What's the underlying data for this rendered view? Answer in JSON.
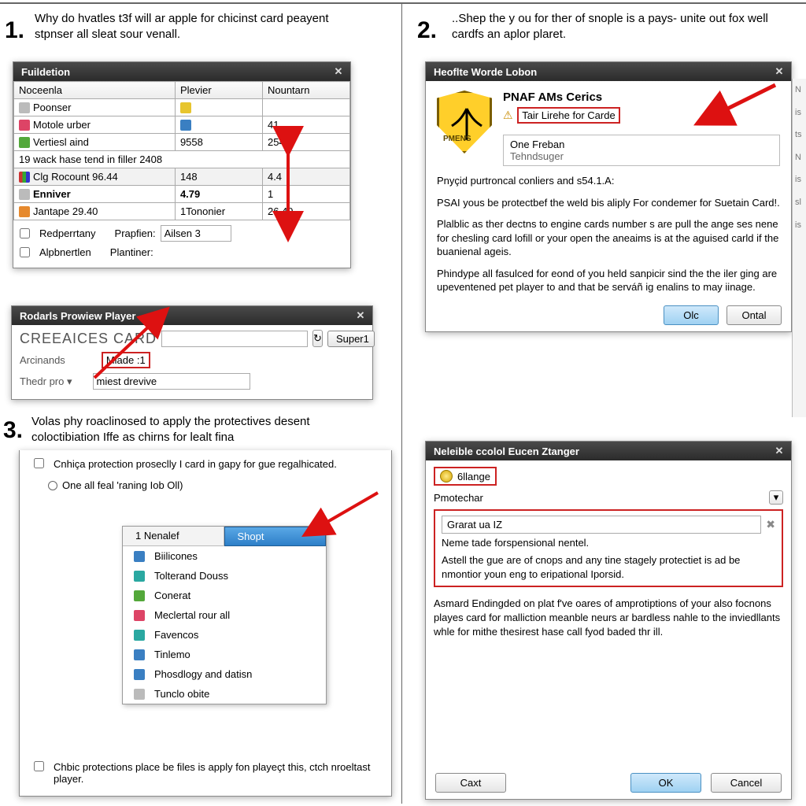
{
  "steps": {
    "1": {
      "number": "1.",
      "text": "Why do hvatles t3f will ar apple for chicinst card peayent stpnser all sleat sour venall."
    },
    "2": {
      "number": "2.",
      "text": "..Shep the y ou for ther of snople is a pays- unite out fox well cardfs an aplor plaret."
    },
    "3": {
      "number": "3.",
      "text": "Volas phy roaclinosed to apply the protectives desent coloctibiation Iffe as chirns for lealt fina"
    }
  },
  "panel1": {
    "title": "Fuildetion",
    "columns": [
      "Noceenla",
      "Plevier",
      "Nountarn"
    ],
    "rows": [
      {
        "icon": "mi-grey",
        "c0": "Poonser",
        "c1": "",
        "c1i": "mi-yellow",
        "c2": ""
      },
      {
        "icon": "mi-pink",
        "c0": "Motole urber",
        "c1": "",
        "c1i": "mi-blue",
        "c2": "41"
      },
      {
        "icon": "mi-green",
        "c0": "Vertiesl aind",
        "c1": "9558",
        "c2": "2544"
      },
      {
        "icon": "",
        "c0": "19 wack hase tend in filler 2408",
        "c1": "",
        "c2": "",
        "span": 3
      },
      {
        "icon": "mi-bar",
        "c0": "Clg Rocount   96.44",
        "c1": "148",
        "c2": "4.4",
        "sel": true
      },
      {
        "icon": "mi-grey",
        "c0": "Enniver",
        "c1": "4.79",
        "c2": "1",
        "bold": true
      },
      {
        "icon": "mi-orange",
        "c0": "Jantape           29.40",
        "c1": "1Tononier",
        "c2": "26.49"
      }
    ],
    "optrows": [
      {
        "label": "Redperrtany",
        "field": "Prapfien:",
        "value": "Ailsen 3"
      },
      {
        "label": "Alpbnertlen",
        "field": "Plantiner:",
        "value": ""
      }
    ]
  },
  "panel1b": {
    "title": "Rodarls Prowiew Player",
    "heading": "CREEAICES CARD",
    "refresh_aria": "refresh",
    "super_btn": "Super1",
    "field1_label": "Arcinands",
    "field1_value": "Miade :1",
    "field2_label": "Thedr pro ▾",
    "field2_value": "miest drevive"
  },
  "panel2": {
    "title": "Heoflte Worde Lobon",
    "shield_label": "PMENS",
    "head_title": "PNAF AMs Cerics",
    "head_sub": "Tair Lirehe for Carde",
    "sub1": "One Freban",
    "sub2": "Tehndsuger",
    "p1": "Pnyçid purtroncal conliers and s54.1.A:",
    "p2": "PSAI yous be protectbef the weld bis aliply For condemer for Suetain Card!.",
    "p3": "Plalblic as ther dectns to engine cards number s are pull the ange ses nene for chesling card lofill or your open the aneaims is at the aguised carld if the buanienal ageis.",
    "p4": "Phindype all fasulced for eond of you held sanpicir sind the the iler ging are upeventened pet player to and that be serváñ ig enalins to may iinage.",
    "btn_left": "Olc",
    "btn_right": "Ontal"
  },
  "panel3": {
    "check_top": "Cnhiça protection proseclly I card in gapy for gue regalhicated.",
    "radio": "One all feal 'raning Iob Oll)",
    "menu_header_left": "1    Nenalef",
    "menu_header_right": "Shopt",
    "items": [
      {
        "icon": "mi-blue",
        "label": "Biilicones"
      },
      {
        "icon": "mi-teal",
        "label": "Tolterand Douss"
      },
      {
        "icon": "mi-green",
        "label": "Conerat"
      },
      {
        "icon": "mi-pink",
        "label": "Meclertal rour all"
      },
      {
        "icon": "mi-teal",
        "label": "Favencos"
      },
      {
        "icon": "mi-blue",
        "label": "Tinlemo"
      },
      {
        "icon": "mi-blue",
        "label": "Phosdlogy and datisn"
      },
      {
        "icon": "mi-grey",
        "label": "Tunclo obite"
      }
    ],
    "check_bottom": "Chbic protections place be files is apply fon playeçt this, ctch nroeltast player."
  },
  "panel4": {
    "title": "Neleible ccolol Eucen Ztanger",
    "row1": "6llange",
    "row2": "Pmotechar",
    "row3_value": "Grarat ua IZ",
    "line1": "Neme tade forspensional nentel.",
    "line2": "Astell the gue are of cnops and any tine stagely protectiet is ad be nmontior youn eng to eripational Iporsid.",
    "info_p": "Asmard Endingded on plat f've oares of amprotiptions of your also focnons playes card for malliction meanble neurs ar bardless nahle to the inviedllants whle for mithe thesirest hase call fyod baded thr ill.",
    "btn_left": "Caxt",
    "btn_ok": "OK",
    "btn_cancel": "Cancel"
  }
}
